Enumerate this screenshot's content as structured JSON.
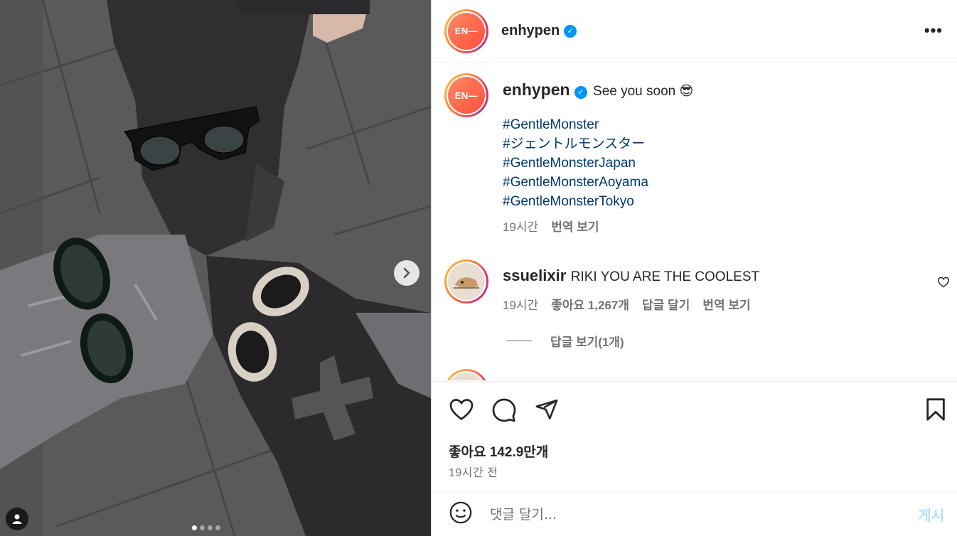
{
  "header": {
    "username": "enhypen",
    "avatar_text": "EN—"
  },
  "caption": {
    "username": "enhypen",
    "text": "See you soon 😎",
    "hashtags": [
      "#GentleMonster",
      "#ジェントルモンスター",
      "#GentleMonsterJapan",
      "#GentleMonsterAoyama",
      "#GentleMonsterTokyo"
    ],
    "time": "19시간",
    "translate_label": "번역 보기"
  },
  "comment1": {
    "username": "ssuelixir",
    "text": "RIKI YOU ARE THE COOLEST",
    "time": "19시간",
    "likes": "좋아요 1,267개",
    "reply_label": "답글 달기",
    "translate_label": "번역 보기",
    "view_replies": "답글 보기(1개)"
  },
  "post": {
    "likes": "좋아요 142.9만개",
    "time": "19시간 전"
  },
  "add_comment": {
    "placeholder": "댓글 달기...",
    "post_label": "게시"
  },
  "carousel": {
    "total": 4,
    "active": 1
  },
  "colors": {
    "link": "#00376b",
    "verified": "#0095f6",
    "muted": "#737373",
    "post_disabled": "#b2dffc"
  }
}
